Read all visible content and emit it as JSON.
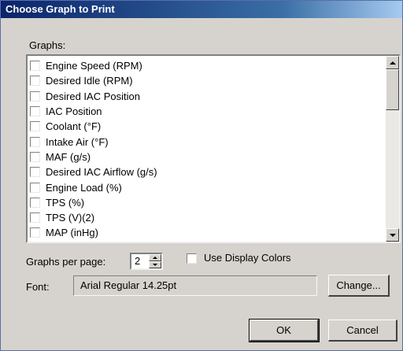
{
  "window": {
    "title": "Choose Graph to Print"
  },
  "graphs": {
    "label": "Graphs:",
    "items": [
      {
        "label": "Engine Speed (RPM)",
        "checked": false
      },
      {
        "label": "Desired Idle (RPM)",
        "checked": false
      },
      {
        "label": "Desired IAC Position",
        "checked": false
      },
      {
        "label": "IAC Position",
        "checked": false
      },
      {
        "label": "Coolant (°F)",
        "checked": false
      },
      {
        "label": "Intake Air (°F)",
        "checked": false
      },
      {
        "label": "MAF (g/s)",
        "checked": false
      },
      {
        "label": "Desired IAC Airflow (g/s)",
        "checked": false
      },
      {
        "label": "Engine Load (%)",
        "checked": false
      },
      {
        "label": "TPS (%)",
        "checked": false
      },
      {
        "label": "TPS (V)(2)",
        "checked": false
      },
      {
        "label": "MAP (inHg)",
        "checked": false
      }
    ]
  },
  "graphs_per_page": {
    "label": "Graphs per page:",
    "value": "2"
  },
  "use_display_colors": {
    "label": "Use Display Colors",
    "checked": false
  },
  "font": {
    "label": "Font:",
    "value": "Arial Regular 14.25pt",
    "change_label": "Change..."
  },
  "buttons": {
    "ok": "OK",
    "cancel": "Cancel"
  }
}
